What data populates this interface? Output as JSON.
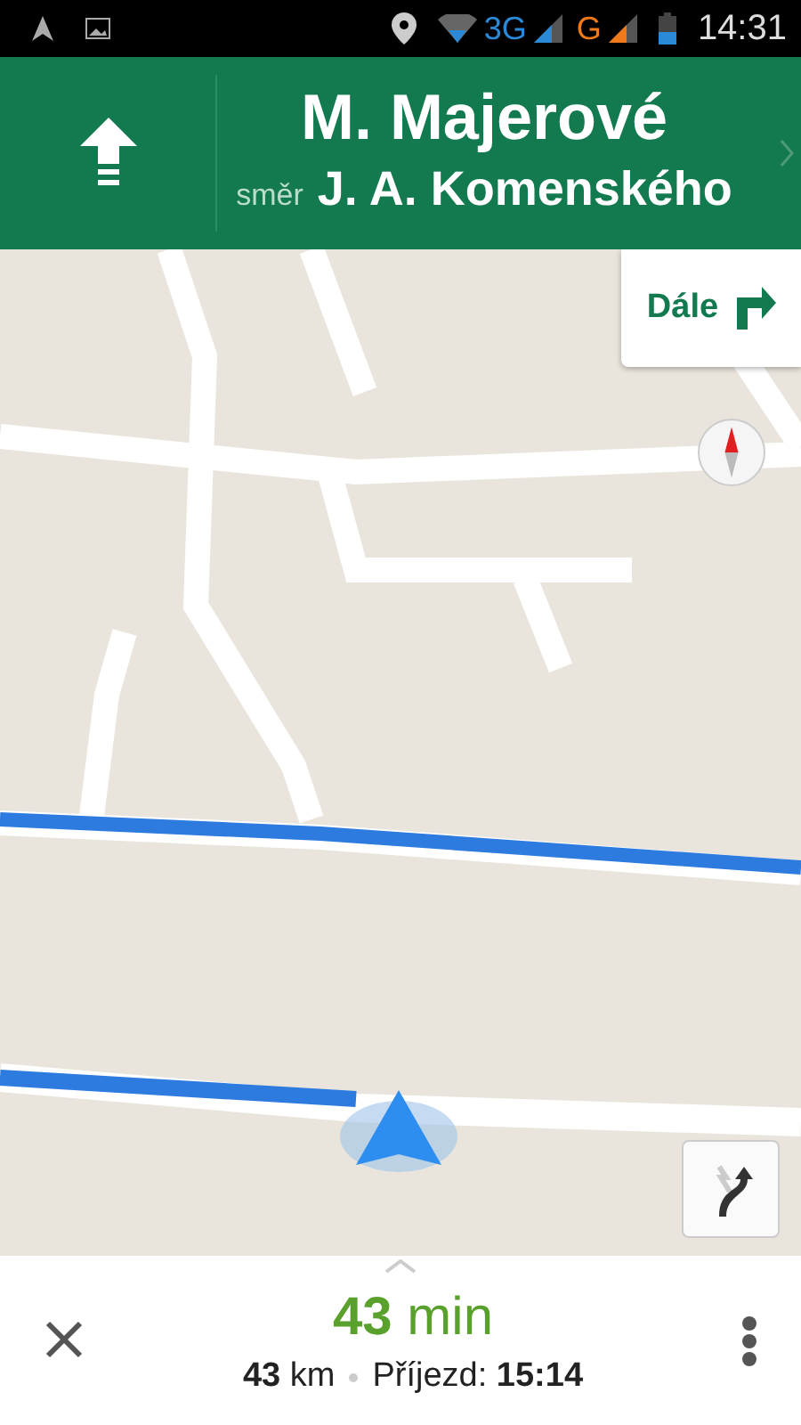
{
  "status_bar": {
    "network_1": "3G",
    "network_2": "G",
    "time": "14:31"
  },
  "instruction": {
    "street": "M. Majerové",
    "toward_prefix": "směr",
    "toward": "J. A. Komenského"
  },
  "next_step": {
    "label": "Dále"
  },
  "trip": {
    "duration": "**43** min",
    "distance": "**43** km",
    "arrival": "Příjezd: **15:14**"
  }
}
